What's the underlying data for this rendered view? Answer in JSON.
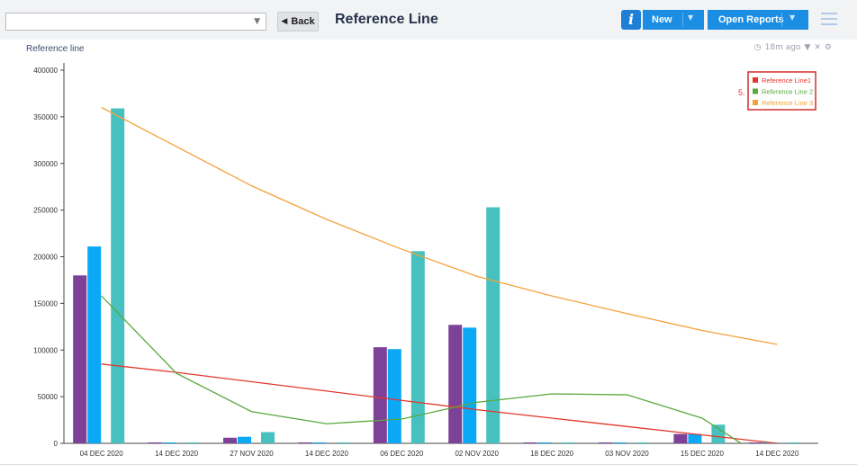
{
  "toolbar": {
    "select_value": "",
    "back_label": "Back",
    "title": "Reference Line",
    "info_label": "i",
    "new_label": "New",
    "open_reports_label": "Open Reports"
  },
  "widget": {
    "title": "Reference line",
    "age": "18m ago"
  },
  "legend_annotation": "5.",
  "colors": {
    "bar1": "#7d4197",
    "bar2": "#0ba9f5",
    "bar3": "#47c1bf",
    "ref1": "#e3382b",
    "ref2": "#5aa83e",
    "ref3": "#f4a13b"
  },
  "chart_data": {
    "type": "bar",
    "categories": [
      "04 DEC 2020",
      "14 DEC 2020",
      "27 NOV 2020",
      "14 DEC 2020",
      "06 DEC 2020",
      "02 NOV 2020",
      "18 DEC 2020",
      "03 NOV 2020",
      "15 DEC 2020",
      "14 DEC 2020"
    ],
    "series": [
      {
        "values": [
          180000,
          0,
          6000,
          0,
          103000,
          127000,
          0,
          0,
          10000,
          0
        ]
      },
      {
        "values": [
          211000,
          0,
          7000,
          0,
          101000,
          124000,
          0,
          0,
          10000,
          0
        ]
      },
      {
        "values": [
          359000,
          0,
          12000,
          0,
          206000,
          253000,
          0,
          0,
          20000,
          0
        ]
      }
    ],
    "lines": [
      {
        "name": "Reference Line1",
        "values": [
          85000,
          76000,
          66000,
          56000,
          46000,
          36000,
          27000,
          18000,
          9000,
          0
        ]
      },
      {
        "name": "Reference Line 2",
        "values": [
          158000,
          75000,
          34000,
          21000,
          26000,
          44000,
          53000,
          52000,
          27000,
          -25000
        ]
      },
      {
        "name": "Reference Line 3",
        "values": [
          360000,
          318000,
          276000,
          240000,
          208000,
          179000,
          158000,
          139000,
          121000,
          106000
        ]
      }
    ],
    "yticks": [
      "400000",
      "350000",
      "300000",
      "250000",
      "200000",
      "150000",
      "100000",
      "50000",
      "0"
    ],
    "ylim": [
      0,
      400000
    ],
    "legend_position": "top-right"
  }
}
